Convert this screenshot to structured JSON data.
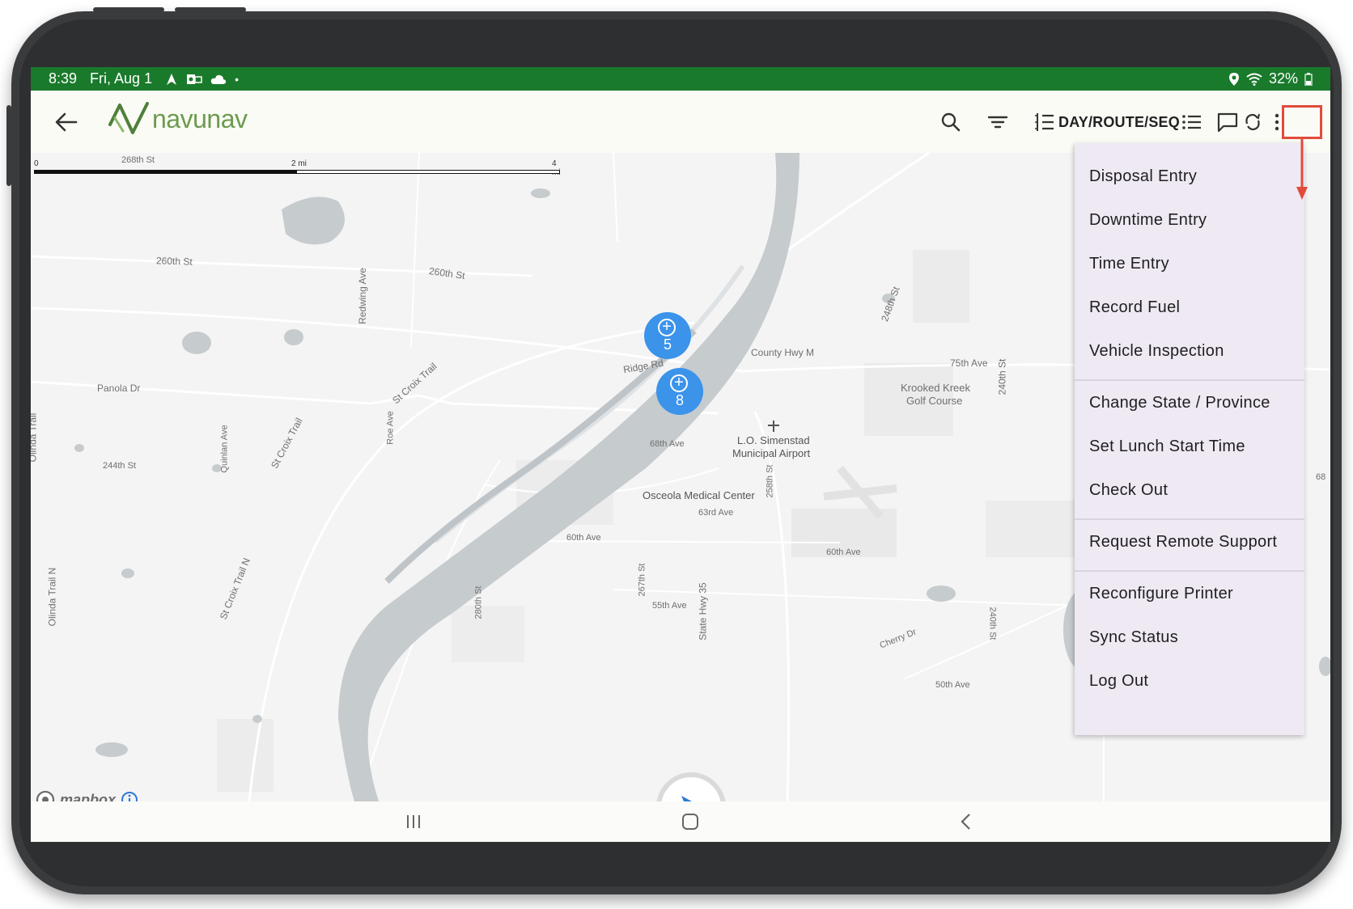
{
  "status_bar": {
    "time": "8:39",
    "date": "Fri, Aug 1",
    "dot": "•",
    "battery": "32%",
    "bg_color": "#197a2b"
  },
  "app_bar": {
    "logo_text": "navunav",
    "sort_label": "DAY/ROUTE/SEQ",
    "icons": [
      "arrow-left-icon",
      "search-icon",
      "filter-icon",
      "sort-list-icon",
      "list-icon",
      "chat-icon",
      "sync-icon",
      "more-vert-icon"
    ]
  },
  "map": {
    "scale": {
      "start": "0",
      "mid": "2 mi",
      "end": "4 mi"
    },
    "streets": {
      "s268th": "268th St",
      "s260th_a": "260th St",
      "s260th_b": "260th St",
      "redwing": "Redwing Ave",
      "panola": "Panola Dr",
      "stcroix_trail": "St Croix Trail",
      "ridge": "Ridge Rd",
      "county_m": "County Hwy M",
      "ave75": "75th Ave",
      "s240th": "240th St",
      "s248th": "248th St",
      "krooked_1": "Krooked Kreek",
      "krooked_2": "Golf Course",
      "airport_1": "L.O. Simenstad",
      "airport_2": "Municipal Airport",
      "ave68": "68th Ave",
      "s258th": "258th St",
      "osceola": "Osceola Medical Center",
      "ave63": "63rd Ave",
      "ave60_a": "60th Ave",
      "ave60_b": "60th Ave",
      "s244th": "244th St",
      "quinlan": "Quinlan Ave",
      "roe": "Roe Ave",
      "stcroix_trail2": "St Croix Trail",
      "stcroix_trailn": "St Croix Trail N",
      "olinda_n": "Olinda Trail N",
      "olinda": "Olinda Trail",
      "s280th": "280th St",
      "s267th": "267th St",
      "hwy35": "State Hwy 35",
      "ave55": "55th Ave",
      "cherry": "Cherry Dr",
      "ave50": "50th Ave",
      "s240th_b": "240th St",
      "edge68": "68"
    },
    "clusters": [
      {
        "count": "5"
      },
      {
        "count": "8"
      }
    ],
    "attribution": "mapbox",
    "cluster_color": "#3b93ea"
  },
  "menu": {
    "items": [
      "Disposal Entry",
      "Downtime Entry",
      "Time Entry",
      "Record Fuel",
      "Vehicle Inspection",
      "Change State / Province",
      "Set Lunch Start Time",
      "Check Out",
      "Request Remote Support",
      "Reconfigure Printer",
      "Sync Status",
      "Log Out"
    ],
    "bg_color": "#efe9f4"
  },
  "highlight_color": "#e14b3b"
}
